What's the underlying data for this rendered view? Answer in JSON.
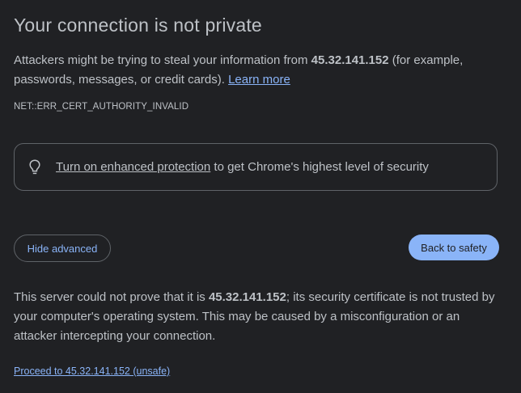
{
  "heading": "Your connection is not private",
  "intro": {
    "prefix": "Attackers might be trying to steal your information from ",
    "host": "45.32.141.152",
    "suffix": " (for example, passwords, messages, or credit cards). ",
    "learn_more": "Learn more"
  },
  "error_code": "NET::ERR_CERT_AUTHORITY_INVALID",
  "enhanced_protection": {
    "icon": "lightbulb-icon",
    "link_text": "Turn on enhanced protection",
    "rest_text": " to get Chrome's highest level of security"
  },
  "buttons": {
    "hide_advanced": "Hide advanced",
    "back_to_safety": "Back to safety"
  },
  "details": {
    "prefix": "This server could not prove that it is ",
    "host": "45.32.141.152",
    "suffix": "; its security certificate is not trusted by your computer's operating system. This may be caused by a misconfiguration or an attacker intercepting your connection."
  },
  "proceed_link": "Proceed to 45.32.141.152 (unsafe)",
  "colors": {
    "background": "#202124",
    "text": "#bdc1c6",
    "accent": "#8ab4f8",
    "border": "#5f6368"
  }
}
